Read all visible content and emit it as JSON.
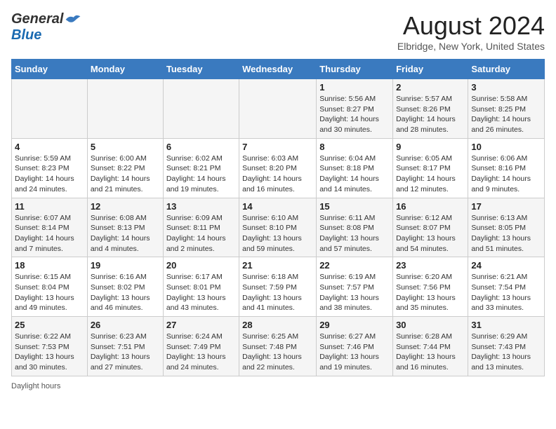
{
  "header": {
    "logo_general": "General",
    "logo_blue": "Blue",
    "title": "August 2024",
    "subtitle": "Elbridge, New York, United States"
  },
  "days_of_week": [
    "Sunday",
    "Monday",
    "Tuesday",
    "Wednesday",
    "Thursday",
    "Friday",
    "Saturday"
  ],
  "weeks": [
    [
      {
        "day": "",
        "info": ""
      },
      {
        "day": "",
        "info": ""
      },
      {
        "day": "",
        "info": ""
      },
      {
        "day": "",
        "info": ""
      },
      {
        "day": "1",
        "info": "Sunrise: 5:56 AM\nSunset: 8:27 PM\nDaylight: 14 hours and 30 minutes."
      },
      {
        "day": "2",
        "info": "Sunrise: 5:57 AM\nSunset: 8:26 PM\nDaylight: 14 hours and 28 minutes."
      },
      {
        "day": "3",
        "info": "Sunrise: 5:58 AM\nSunset: 8:25 PM\nDaylight: 14 hours and 26 minutes."
      }
    ],
    [
      {
        "day": "4",
        "info": "Sunrise: 5:59 AM\nSunset: 8:23 PM\nDaylight: 14 hours and 24 minutes."
      },
      {
        "day": "5",
        "info": "Sunrise: 6:00 AM\nSunset: 8:22 PM\nDaylight: 14 hours and 21 minutes."
      },
      {
        "day": "6",
        "info": "Sunrise: 6:02 AM\nSunset: 8:21 PM\nDaylight: 14 hours and 19 minutes."
      },
      {
        "day": "7",
        "info": "Sunrise: 6:03 AM\nSunset: 8:20 PM\nDaylight: 14 hours and 16 minutes."
      },
      {
        "day": "8",
        "info": "Sunrise: 6:04 AM\nSunset: 8:18 PM\nDaylight: 14 hours and 14 minutes."
      },
      {
        "day": "9",
        "info": "Sunrise: 6:05 AM\nSunset: 8:17 PM\nDaylight: 14 hours and 12 minutes."
      },
      {
        "day": "10",
        "info": "Sunrise: 6:06 AM\nSunset: 8:16 PM\nDaylight: 14 hours and 9 minutes."
      }
    ],
    [
      {
        "day": "11",
        "info": "Sunrise: 6:07 AM\nSunset: 8:14 PM\nDaylight: 14 hours and 7 minutes."
      },
      {
        "day": "12",
        "info": "Sunrise: 6:08 AM\nSunset: 8:13 PM\nDaylight: 14 hours and 4 minutes."
      },
      {
        "day": "13",
        "info": "Sunrise: 6:09 AM\nSunset: 8:11 PM\nDaylight: 14 hours and 2 minutes."
      },
      {
        "day": "14",
        "info": "Sunrise: 6:10 AM\nSunset: 8:10 PM\nDaylight: 13 hours and 59 minutes."
      },
      {
        "day": "15",
        "info": "Sunrise: 6:11 AM\nSunset: 8:08 PM\nDaylight: 13 hours and 57 minutes."
      },
      {
        "day": "16",
        "info": "Sunrise: 6:12 AM\nSunset: 8:07 PM\nDaylight: 13 hours and 54 minutes."
      },
      {
        "day": "17",
        "info": "Sunrise: 6:13 AM\nSunset: 8:05 PM\nDaylight: 13 hours and 51 minutes."
      }
    ],
    [
      {
        "day": "18",
        "info": "Sunrise: 6:15 AM\nSunset: 8:04 PM\nDaylight: 13 hours and 49 minutes."
      },
      {
        "day": "19",
        "info": "Sunrise: 6:16 AM\nSunset: 8:02 PM\nDaylight: 13 hours and 46 minutes."
      },
      {
        "day": "20",
        "info": "Sunrise: 6:17 AM\nSunset: 8:01 PM\nDaylight: 13 hours and 43 minutes."
      },
      {
        "day": "21",
        "info": "Sunrise: 6:18 AM\nSunset: 7:59 PM\nDaylight: 13 hours and 41 minutes."
      },
      {
        "day": "22",
        "info": "Sunrise: 6:19 AM\nSunset: 7:57 PM\nDaylight: 13 hours and 38 minutes."
      },
      {
        "day": "23",
        "info": "Sunrise: 6:20 AM\nSunset: 7:56 PM\nDaylight: 13 hours and 35 minutes."
      },
      {
        "day": "24",
        "info": "Sunrise: 6:21 AM\nSunset: 7:54 PM\nDaylight: 13 hours and 33 minutes."
      }
    ],
    [
      {
        "day": "25",
        "info": "Sunrise: 6:22 AM\nSunset: 7:53 PM\nDaylight: 13 hours and 30 minutes."
      },
      {
        "day": "26",
        "info": "Sunrise: 6:23 AM\nSunset: 7:51 PM\nDaylight: 13 hours and 27 minutes."
      },
      {
        "day": "27",
        "info": "Sunrise: 6:24 AM\nSunset: 7:49 PM\nDaylight: 13 hours and 24 minutes."
      },
      {
        "day": "28",
        "info": "Sunrise: 6:25 AM\nSunset: 7:48 PM\nDaylight: 13 hours and 22 minutes."
      },
      {
        "day": "29",
        "info": "Sunrise: 6:27 AM\nSunset: 7:46 PM\nDaylight: 13 hours and 19 minutes."
      },
      {
        "day": "30",
        "info": "Sunrise: 6:28 AM\nSunset: 7:44 PM\nDaylight: 13 hours and 16 minutes."
      },
      {
        "day": "31",
        "info": "Sunrise: 6:29 AM\nSunset: 7:43 PM\nDaylight: 13 hours and 13 minutes."
      }
    ]
  ],
  "footer": {
    "note": "Daylight hours"
  }
}
